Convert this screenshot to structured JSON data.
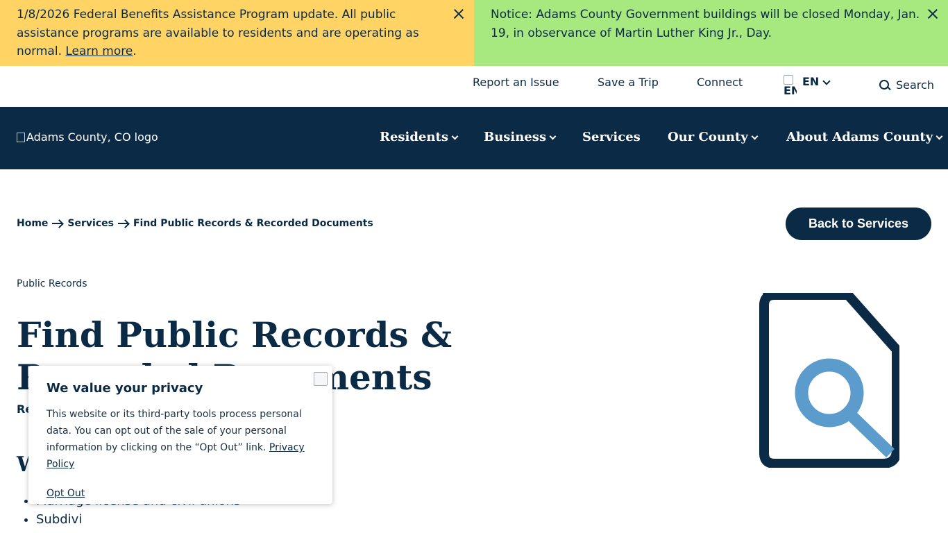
{
  "alerts": {
    "left": {
      "text": "1/8/2026 Federal Benefits Assistance Program update. All public assistance programs are available to residents and are operating as normal. ",
      "link": "Learn more",
      "after": "."
    },
    "right": {
      "text": "Notice: Adams County Government buildings will be closed Monday, Jan. 19, in observance of Martin Luther King Jr., Day."
    }
  },
  "utility": {
    "report": "Report an Issue",
    "save_trip": "Save a Trip",
    "connect": "Connect",
    "flag_text": "EN",
    "language": "EN",
    "search": "Search"
  },
  "nav": {
    "logo_alt": "Adams County, CO logo",
    "residents": "Residents",
    "business": "Business",
    "services": "Services",
    "our_county": "Our County",
    "about": "About Adams County"
  },
  "breadcrumb": {
    "home": "Home",
    "services": "Services",
    "current": "Find Public Records & Recorded Documents"
  },
  "back_button": "Back to Services",
  "content": {
    "category": "Public Records",
    "title": "Find Public Records & Recorded Documents",
    "subtext_visible": "Re",
    "section_visible": "W",
    "list_items": [
      "Marriage license and civil unions",
      "Subdivi"
    ]
  },
  "privacy": {
    "title": "We value your privacy",
    "body": "This website or its third-party tools process personal data. You can opt out of the sale of your personal information by clicking on the “Opt Out” link. ",
    "policy_link": "Privacy Policy",
    "opt_out": "Opt Out"
  },
  "colors": {
    "navy": "#0b2a46",
    "alert_yellow": "#ffd464",
    "alert_green": "#a7e87f",
    "icon_blue": "#5b9ccd"
  },
  "icons": [
    "close-icon",
    "chevron-down-icon",
    "search-icon",
    "arrow-right-icon",
    "document-search-icon"
  ]
}
